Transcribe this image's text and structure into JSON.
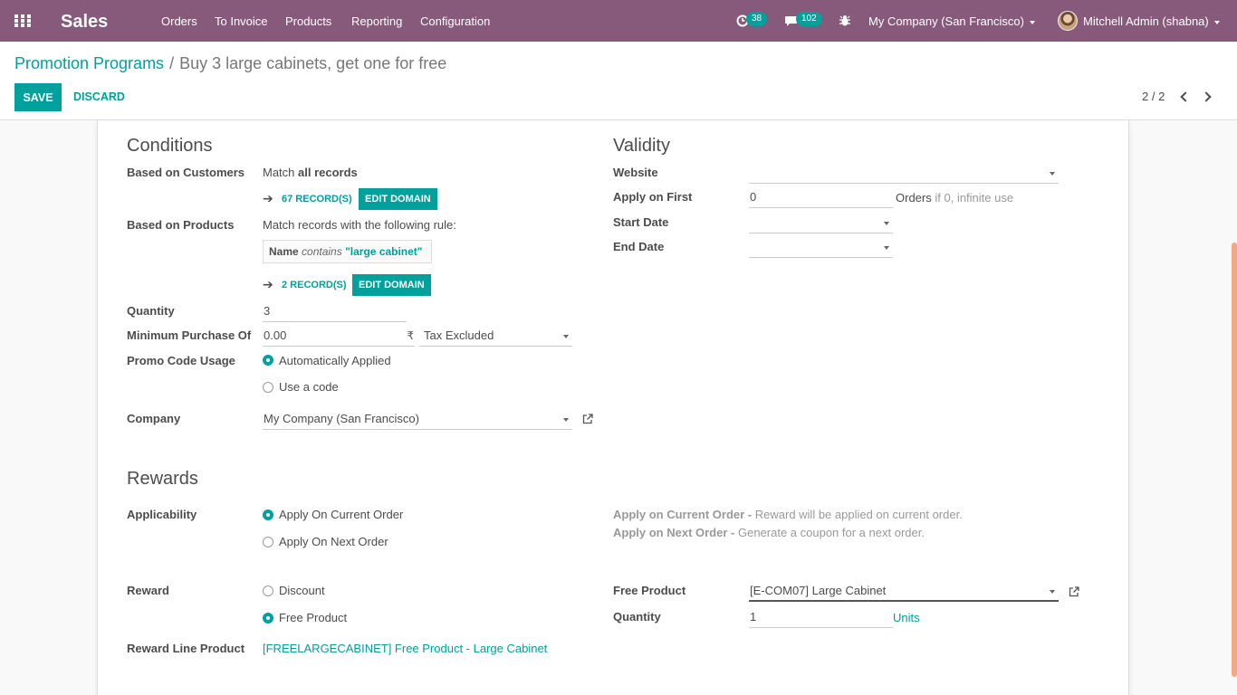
{
  "navbar": {
    "app_title": "Sales",
    "menu": [
      "Orders",
      "To Invoice",
      "Products",
      "Reporting",
      "Configuration"
    ],
    "activity_count": "38",
    "message_count": "102",
    "company": "My Company (San Francisco)",
    "user": "Mitchell Admin (shabna)"
  },
  "breadcrumb": {
    "parent": "Promotion Programs",
    "separator": "/",
    "current": "Buy 3 large cabinets, get one for free"
  },
  "toolbar": {
    "save_label": "SAVE",
    "discard_label": "DISCARD"
  },
  "pager": {
    "value": "2 / 2"
  },
  "conditions": {
    "title": "Conditions",
    "based_on_customers": {
      "label": "Based on Customers",
      "text_prefix": "Match",
      "text_bold": "all records",
      "records": "67 RECORD(S)",
      "edit_label": "EDIT DOMAIN"
    },
    "based_on_products": {
      "label": "Based on Products",
      "text": "Match records with the following rule:",
      "rule_field": "Name",
      "rule_operator": "contains",
      "rule_value": "\"large cabinet\"",
      "records": "2 RECORD(S)",
      "edit_label": "EDIT DOMAIN"
    },
    "quantity": {
      "label": "Quantity",
      "value": "3"
    },
    "minimum_purchase": {
      "label": "Minimum Purchase Of",
      "value": "0.00",
      "currency": "₹",
      "tax": "Tax Excluded"
    },
    "promo_code_usage": {
      "label": "Promo Code Usage",
      "options": [
        "Automatically Applied",
        "Use a code"
      ],
      "selected": 0
    },
    "company": {
      "label": "Company",
      "value": "My Company (San Francisco)"
    }
  },
  "validity": {
    "title": "Validity",
    "website": {
      "label": "Website",
      "value": ""
    },
    "apply_on_first": {
      "label": "Apply on First",
      "value": "0",
      "suffix": "Orders",
      "hint": "if 0, infinite use"
    },
    "start_date": {
      "label": "Start Date",
      "value": ""
    },
    "end_date": {
      "label": "End Date",
      "value": ""
    }
  },
  "rewards": {
    "title": "Rewards",
    "applicability": {
      "label": "Applicability",
      "options": [
        "Apply On Current Order",
        "Apply On Next Order"
      ],
      "selected": 0
    },
    "help": [
      {
        "term": "Apply on Current Order -",
        "desc": "Reward will be applied on current order."
      },
      {
        "term": "Apply on Next Order -",
        "desc": "Generate a coupon for a next order."
      }
    ],
    "reward": {
      "label": "Reward",
      "options": [
        "Discount",
        "Free Product"
      ],
      "selected": 1
    },
    "reward_line_product": {
      "label": "Reward Line Product",
      "value": "[FREELARGECABINET] Free Product - Large Cabinet"
    },
    "free_product": {
      "label": "Free Product",
      "value": "[E-COM07] Large Cabinet"
    },
    "quantity": {
      "label": "Quantity",
      "value": "1",
      "unit": "Units"
    }
  },
  "colors": {
    "brand": "#875a7b",
    "accent": "#00a09d"
  }
}
